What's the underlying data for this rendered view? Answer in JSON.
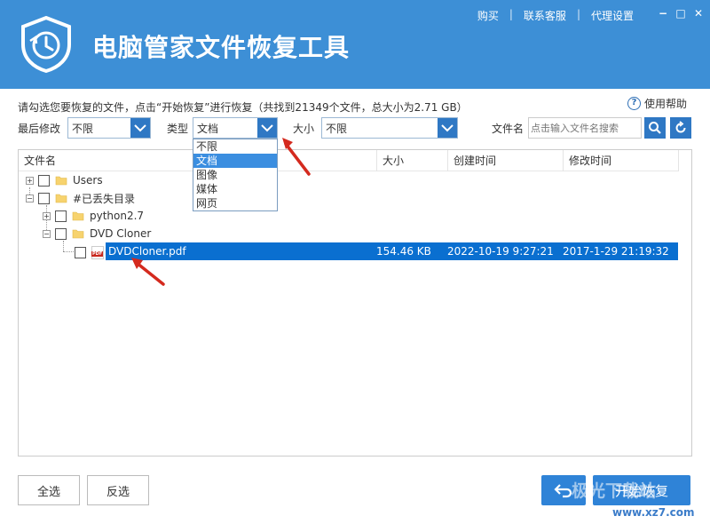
{
  "app": {
    "title": "电脑管家文件恢复工具",
    "top_links": [
      "购买",
      "联系客服",
      "代理设置"
    ],
    "window_buttons": {
      "minimize": "−",
      "maximize": "□",
      "close": "✕"
    }
  },
  "info": {
    "summary": "请勾选您要恢复的文件，点击“开始恢复”进行恢复（共找到21349个文件，总大小为2.71 GB）",
    "help_label": "使用帮助",
    "help_icon": "?"
  },
  "filters": {
    "last_modified_label": "最后修改",
    "last_modified_value": "不限",
    "type_label": "类型",
    "type_value": "文档",
    "size_label": "大小",
    "size_value": "不限",
    "filename_label": "文件名",
    "filename_placeholder": "点击输入文件名搜索"
  },
  "type_dropdown": {
    "options": [
      "不限",
      "文档",
      "图像",
      "媒体",
      "网页"
    ],
    "selected_index": 1
  },
  "columns": {
    "name": "文件名",
    "size": "大小",
    "created": "创建时间",
    "modified": "修改时间"
  },
  "tree": {
    "users": "Users",
    "lost_dir": "#已丢失目录",
    "python": "python2.7",
    "dvd_folder": "DVD Cloner",
    "file": {
      "name": "DVDCloner.pdf",
      "size": "154.46 KB",
      "created": "2022-10-19 9:27:21",
      "modified": "2017-1-29 21:19:32",
      "icon_text": "PDF"
    }
  },
  "buttons": {
    "select_all": "全选",
    "invert": "反选",
    "start": "开始恢复"
  },
  "watermark": {
    "main": "极光下载站",
    "sub": "www.xz7.com"
  },
  "colors": {
    "brand_blue": "#3d8fd6",
    "button_blue": "#2f83d7",
    "selection": "#0a6fd0",
    "annotation_red": "#d42a1e"
  }
}
